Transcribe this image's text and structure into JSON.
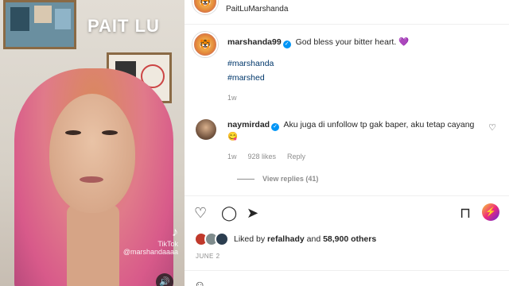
{
  "media": {
    "overlay_title": "PAIT LU",
    "tiktok_logo": "♪",
    "tiktok_label": "TikTok",
    "tiktok_handle": "@marshandaaaa",
    "sound_icon": "🔊"
  },
  "post": {
    "top_partial_user": "PaitLuMarshanda",
    "more_icon": "⋯"
  },
  "caption": {
    "username": "marshanda99",
    "text": "God bless your bitter heart. 💜",
    "hashtags": [
      "#marshanda",
      "#marshed"
    ],
    "time": "1w"
  },
  "comment": {
    "username": "naymirdad",
    "text": "Aku juga di unfollow tp gak baper, aku tetap cayang 😋",
    "time": "1w",
    "likes": "928 likes",
    "reply": "Reply",
    "view_replies": "View replies (41)"
  },
  "actions": {
    "like_icon": "♡",
    "comment_icon": "◯",
    "share_icon": "➤",
    "save_icon": "⊓",
    "promo_icon": "⚡"
  },
  "likes": {
    "prefix": "Liked by ",
    "user": "refalhady",
    "middle": " and ",
    "count": "58,900 others"
  },
  "date": "JUNE 2",
  "add_comment_icon": "☺"
}
